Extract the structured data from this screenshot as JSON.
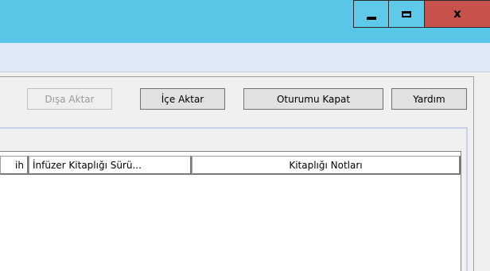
{
  "titlebar": {
    "accent": "#58c6e6",
    "close_color": "#c7524b",
    "minimize_icon": "minimize-icon",
    "maximize_icon": "maximize-icon",
    "close_label": "x"
  },
  "toolbar": {
    "export_label": "Dışa Aktar",
    "import_label": "İçe Aktar",
    "logout_label": "Oturumu Kapat",
    "help_label": "Yardım"
  },
  "table": {
    "columns": [
      "ih",
      "İnfüzer Kitaplığı Sürü...",
      "Kitaplığı Notları"
    ]
  }
}
